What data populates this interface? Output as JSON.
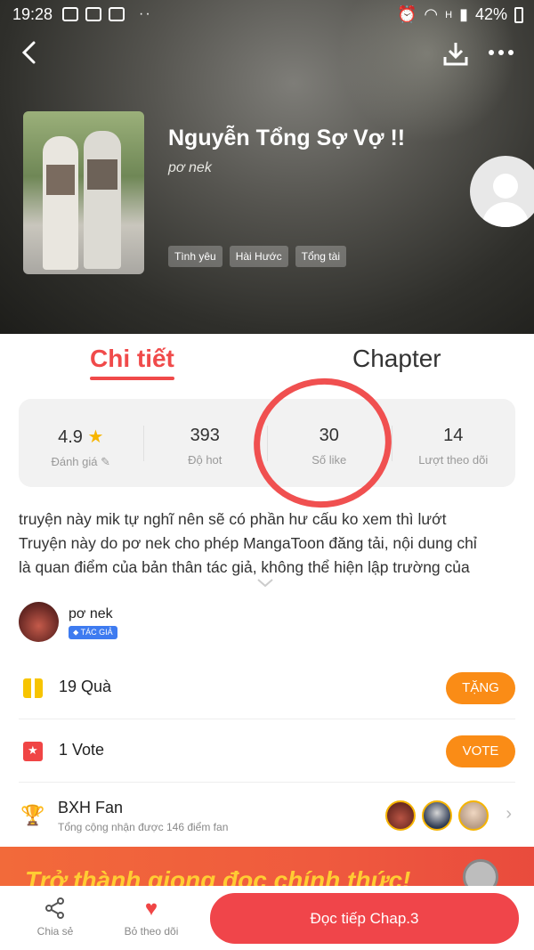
{
  "status_bar": {
    "time": "19:28",
    "network": "H",
    "battery": "42%"
  },
  "story": {
    "title": "Nguyễn Tổng Sợ Vợ !!",
    "author": "pơ nek",
    "tags": [
      "Tình yêu",
      "Hài Hước",
      "Tổng tài"
    ]
  },
  "tabs": {
    "detail": "Chi tiết",
    "chapter": "Chapter"
  },
  "stats": [
    {
      "value": "4.9",
      "label": "Đánh giá"
    },
    {
      "value": "393",
      "label": "Độ hot"
    },
    {
      "value": "30",
      "label": "Số like"
    },
    {
      "value": "14",
      "label": "Lượt theo dõi"
    }
  ],
  "description": {
    "line1": "truyện này mik tự nghĩ nên sẽ có phần hư cấu ko xem thì lướt",
    "line2": "Truyện này do pơ nek cho phép MangaToon đăng tải, nội dung chỉ",
    "line3": "là quan điểm của bản thân tác giả, không thể hiện lập trường của"
  },
  "author_block": {
    "name": "pơ nek",
    "badge": "TÁC GIẢ"
  },
  "gifts": {
    "count_text": "19 Quà",
    "button": "TẶNG"
  },
  "votes": {
    "count_text": "1 Vote",
    "button": "VOTE"
  },
  "fan_rank": {
    "title": "BXH Fan",
    "subtitle": "Tổng cộng nhận được 146 điểm fan"
  },
  "banner": {
    "text": "Trở thành giọng đọc chính thức!"
  },
  "bottom": {
    "share": "Chia sẻ",
    "unfollow": "Bỏ theo dõi",
    "read": "Đọc tiếp Chap.3"
  }
}
